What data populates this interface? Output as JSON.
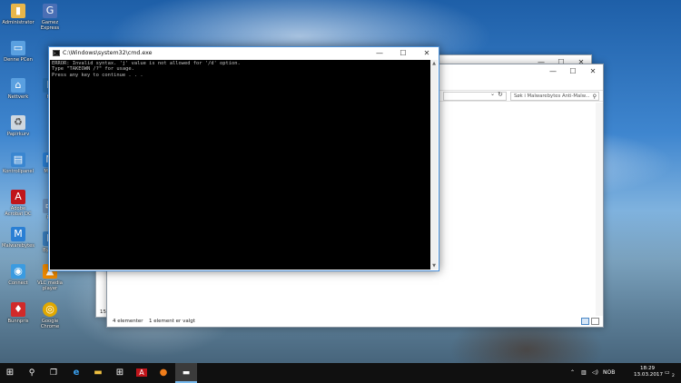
{
  "desktop": {
    "icons": [
      {
        "label": "Administrator",
        "icon": "folder-user-icon",
        "color": "#e8b64a"
      },
      {
        "label": "Denne PCen",
        "icon": "computer-icon",
        "color": "#5aa0e0"
      },
      {
        "label": "Nettverk",
        "icon": "network-icon",
        "color": "#5aa0e0"
      },
      {
        "label": "Papirkurv",
        "icon": "recycle-bin-icon",
        "color": "#cfd8e0"
      },
      {
        "label": "Kontrollpanel",
        "icon": "control-panel-icon",
        "color": "#3a86d0"
      },
      {
        "label": "Adobe Acrobat DC",
        "icon": "acrobat-icon",
        "color": "#c0151b"
      },
      {
        "label": "Malwarebytes",
        "icon": "malwarebytes-icon",
        "color": "#2a7fd4"
      },
      {
        "label": "Connect",
        "icon": "connect-icon",
        "color": "#3b9be0"
      },
      {
        "label": "Bunnpris",
        "icon": "bunnpris-icon",
        "color": "#d12a2a"
      },
      {
        "label": "Gamez Express",
        "icon": "gamez-icon",
        "color": "#4a6fb5"
      },
      {
        "label": "VLC media player",
        "icon": "vlc-icon",
        "color": "#f08a00"
      },
      {
        "label": "Google Chrome",
        "icon": "chrome-icon",
        "color": "#e0a800"
      }
    ],
    "icons_col2_partial": [
      "HP",
      "Malw",
      "PC",
      "Bypas"
    ]
  },
  "cmd": {
    "title": "C:\\Windows\\system32\\cmd.exe",
    "lines": [
      "ERROR: Invalid syntax. 'j' value is not allowed for '/d' option.",
      "Type \"TAKEOWN /?\" for usage.",
      "Press any key to continue . . ."
    ],
    "minimize": "—",
    "maximize": "☐",
    "close": "✕"
  },
  "explorer": {
    "search_placeholder": "Søk i Malwarebytes Anti-Malw...",
    "status_count": "4 elementer",
    "status_selected": "1 element er valgt",
    "left_fragment": "15"
  },
  "taskbar": {
    "time": "18:29",
    "date": "13.03.2017",
    "language": "NOB",
    "notification_count": "2"
  }
}
